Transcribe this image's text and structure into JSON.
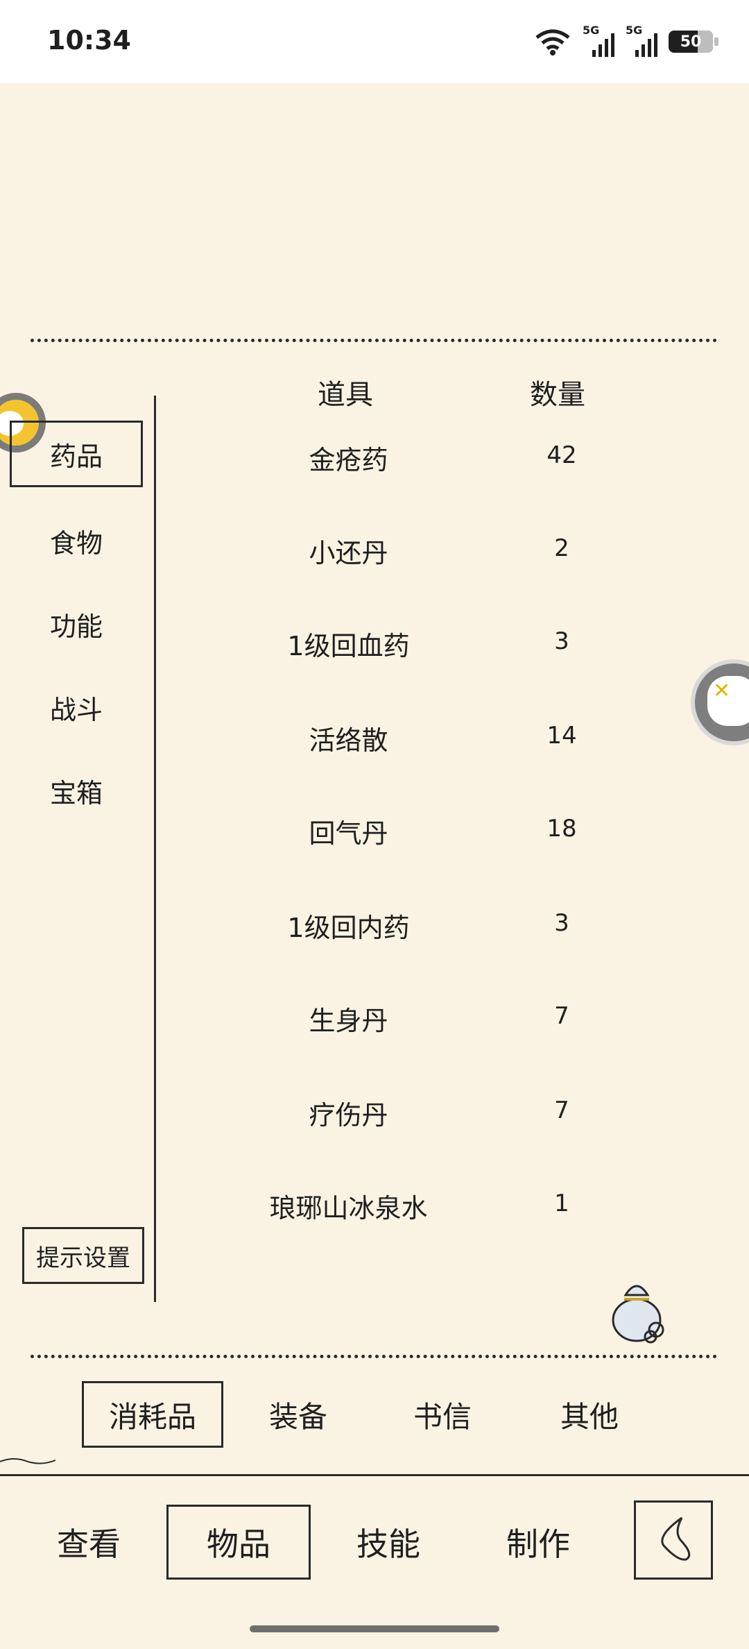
{
  "status": {
    "time": "10:34",
    "signal1": "5G",
    "signal2": "5G",
    "battery": "50"
  },
  "categories": [
    {
      "label": "药品",
      "selected": true
    },
    {
      "label": "食物",
      "selected": false
    },
    {
      "label": "功能",
      "selected": false
    },
    {
      "label": "战斗",
      "selected": false
    },
    {
      "label": "宝箱",
      "selected": false
    }
  ],
  "hint_button": "提示设置",
  "table": {
    "headers": {
      "item": "道具",
      "qty": "数量"
    },
    "rows": [
      {
        "name": "金疮药",
        "qty": "42"
      },
      {
        "name": "小还丹",
        "qty": "2"
      },
      {
        "name": "1级回血药",
        "qty": "3"
      },
      {
        "name": "活络散",
        "qty": "14"
      },
      {
        "name": "回气丹",
        "qty": "18"
      },
      {
        "name": "1级回内药",
        "qty": "3"
      },
      {
        "name": "生身丹",
        "qty": "7"
      },
      {
        "name": "疗伤丹",
        "qty": "7"
      },
      {
        "name": "琅琊山冰泉水",
        "qty": "1"
      }
    ]
  },
  "tabs": [
    {
      "label": "消耗品",
      "selected": true
    },
    {
      "label": "装备",
      "selected": false
    },
    {
      "label": "书信",
      "selected": false
    },
    {
      "label": "其他",
      "selected": false
    }
  ],
  "nav": [
    {
      "label": "查看",
      "selected": false
    },
    {
      "label": "物品",
      "selected": true
    },
    {
      "label": "技能",
      "selected": false
    },
    {
      "label": "制作",
      "selected": false
    }
  ],
  "icons": {
    "avatar": "chicken-avatar-icon",
    "float": "game-controller-icon",
    "bag": "item-bag-icon",
    "back": "back-arrow-icon"
  }
}
